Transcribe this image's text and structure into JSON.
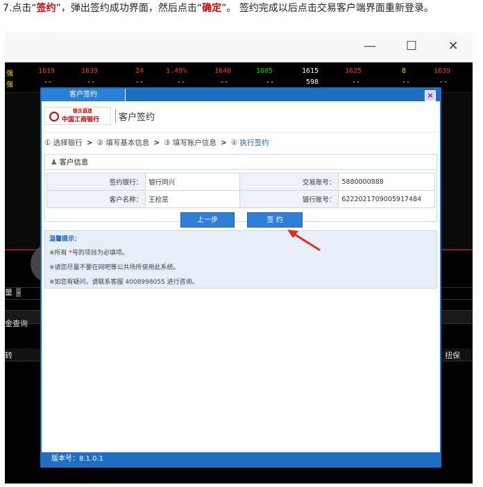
{
  "instruction": {
    "prefix": "7.点击“",
    "sign_word": "签约",
    "middle": "”，弹出签约成功界面，然后点击“",
    "confirm_word": "确定",
    "suffix": "”。 签约完成以后点击交易客户端界面重新登录。"
  },
  "window": {
    "minimize_icon": "—",
    "maximize_icon": "☐",
    "close_icon": "✕"
  },
  "quotes": {
    "row1": {
      "label": "强",
      "c1": "1619",
      "c2": "1639",
      "c3": "24",
      "c4": "1.49%",
      "c5": "1640",
      "c6": "1605",
      "c7": "1615",
      "c8": "1625",
      "c9": "8",
      "c10": "1639"
    },
    "row2": {
      "label": "强",
      "c1": "--",
      "c2": "--",
      "c3": "--",
      "c4": "--",
      "c5": "--",
      "c6": "--",
      "c7": "598",
      "c8": "--",
      "c9": "--",
      "c10": "--"
    }
  },
  "background_labels": {
    "qty": "量",
    "dash": "-",
    "query": "金查询",
    "transfer": "转",
    "report": "扭保"
  },
  "dialog": {
    "tab_label": "客户签约",
    "close_label": "×",
    "brand": {
      "logo_sub": "银企直连",
      "logo_text": "中国工商银行",
      "title": "客户签约"
    },
    "steps": [
      "① 选择银行",
      "② 填写基本信息",
      "③ 填写账户信息",
      "④ 执行签约"
    ],
    "info": {
      "heading": "客户信息",
      "rows": [
        {
          "label1": "签约银行：",
          "value1": "银行同兴",
          "label2": "交易账号：",
          "value2": "5880000888"
        },
        {
          "label1": "客户名称：",
          "value1": "王检茁",
          "label2": "银行账号：",
          "value2": "6222021709005917484"
        }
      ]
    },
    "buttons": {
      "prev": "上一步",
      "sign": "签 约"
    },
    "tips": {
      "title": "温馨提示：",
      "line1_a": "※所有",
      "line1_star": "*",
      "line1_b": "号的项目为必填项。",
      "line2": "※请您尽量不要在网吧等公共场所使用此系统。",
      "line3": "※如您有疑问，请联系客服 4008998055 进行咨询。"
    },
    "footer": "版本号：8.1.0.1"
  },
  "colors": {
    "accent": "#1f6fc5",
    "highlight": "#d00000",
    "pointer": "#e52a1a"
  }
}
